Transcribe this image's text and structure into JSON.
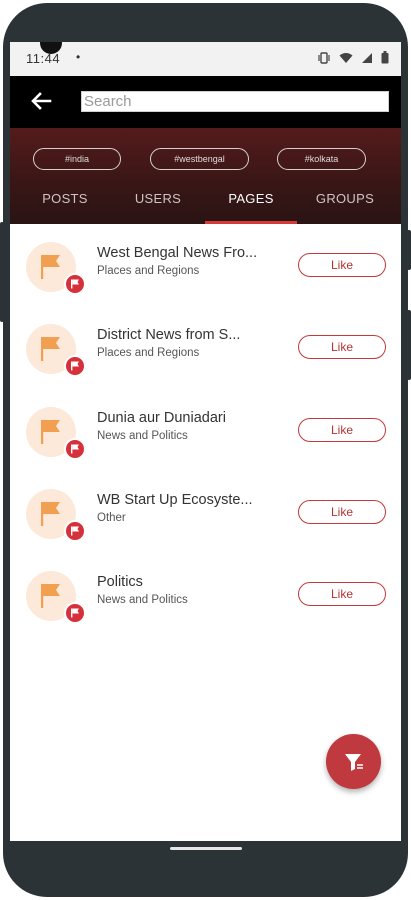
{
  "status_bar": {
    "time": "11:44",
    "dot": "•"
  },
  "search": {
    "placeholder": "Search",
    "value": ""
  },
  "hashtags": [
    "#india",
    "#westbengal",
    "#kolkata"
  ],
  "tabs": [
    {
      "label": "POSTS",
      "active": false
    },
    {
      "label": "USERS",
      "active": false
    },
    {
      "label": "PAGES",
      "active": true
    },
    {
      "label": "GROUPS",
      "active": false
    }
  ],
  "pages": [
    {
      "title": "West Bengal News Fro...",
      "category": "Places and Regions",
      "action": "Like"
    },
    {
      "title": "District News from S...",
      "category": "Places and Regions",
      "action": "Like"
    },
    {
      "title": "Dunia aur Duniadari",
      "category": "News and Politics",
      "action": "Like"
    },
    {
      "title": "WB Start Up Ecosyste...",
      "category": "Other",
      "action": "Like"
    },
    {
      "title": "Politics",
      "category": "News and Politics",
      "action": "Like"
    }
  ],
  "icons": {
    "back": "arrow-left-icon",
    "avatar": "flag-icon",
    "badge": "flag-icon",
    "fab": "filter-icon"
  },
  "colors": {
    "accent": "#c0393f",
    "header_dark": "#2a1414",
    "avatar_bg": "#fde9da",
    "flag": "#f0a050"
  }
}
